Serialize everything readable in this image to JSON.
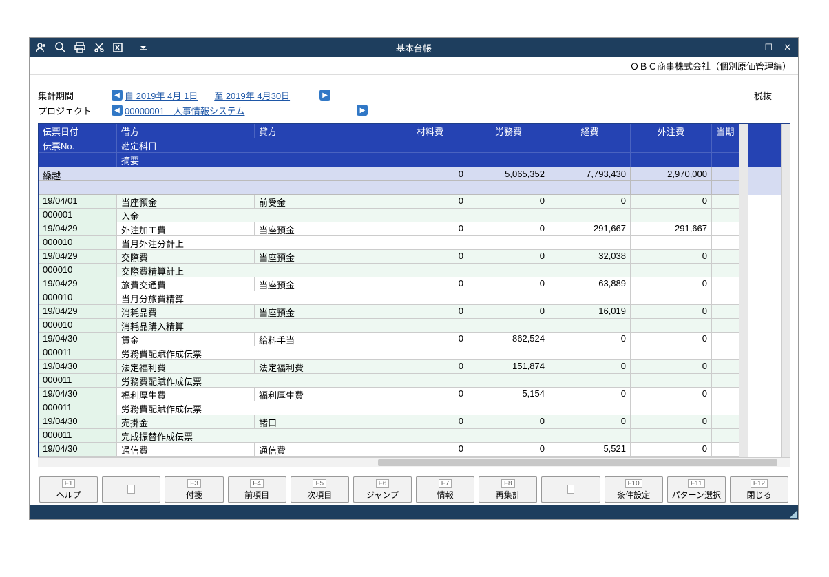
{
  "titlebar": {
    "title": "基本台帳"
  },
  "company": "ＯＢＣ商事株式会社（個別原価管理編）",
  "filters": {
    "period_label": "集計期間",
    "period_from": "自 2019年  4月 1日",
    "period_to": "至 2019年  4月30日",
    "project_label": "プロジェクト",
    "project_value": "00000001　人事情報システム"
  },
  "tax_label": "税抜",
  "headers": {
    "date": "伝票日付",
    "debit": "借方",
    "credit": "貸方",
    "material": "材料費",
    "labor": "労務費",
    "expense": "経費",
    "outsource": "外注費",
    "current": "当期",
    "slip_no": "伝票No.",
    "account": "勘定科目",
    "memo": "摘要"
  },
  "carryover": {
    "label": "繰越",
    "material": "0",
    "labor": "5,065,352",
    "expense": "7,793,430",
    "outsource": "2,970,000"
  },
  "rows": [
    {
      "date": "19/04/01",
      "no": "000001",
      "debit": "当座預金",
      "credit": "前受金",
      "memo": "入金",
      "material": "0",
      "labor": "0",
      "expense": "0",
      "outsource": "0",
      "alt": true
    },
    {
      "date": "19/04/29",
      "no": "000010",
      "debit": "外注加工費",
      "credit": "当座預金",
      "memo": "当月外注分計上",
      "material": "0",
      "labor": "0",
      "expense": "291,667",
      "outsource": "291,667",
      "alt": false
    },
    {
      "date": "19/04/29",
      "no": "000010",
      "debit": "交際費",
      "credit": "当座預金",
      "memo": "交際費精算計上",
      "material": "0",
      "labor": "0",
      "expense": "32,038",
      "outsource": "0",
      "alt": true
    },
    {
      "date": "19/04/29",
      "no": "000010",
      "debit": "旅費交通費",
      "credit": "当座預金",
      "memo": "当月分旅費精算",
      "material": "0",
      "labor": "0",
      "expense": "63,889",
      "outsource": "0",
      "alt": false
    },
    {
      "date": "19/04/29",
      "no": "000010",
      "debit": "消耗品費",
      "credit": "当座預金",
      "memo": "消耗品購入精算",
      "material": "0",
      "labor": "0",
      "expense": "16,019",
      "outsource": "0",
      "alt": true
    },
    {
      "date": "19/04/30",
      "no": "000011",
      "debit": "賃金",
      "credit": "給料手当",
      "memo": "労務費配賦作成伝票",
      "material": "0",
      "labor": "862,524",
      "expense": "0",
      "outsource": "0",
      "alt": false
    },
    {
      "date": "19/04/30",
      "no": "000011",
      "debit": "法定福利費",
      "credit": "法定福利費",
      "memo": "労務費配賦作成伝票",
      "material": "0",
      "labor": "151,874",
      "expense": "0",
      "outsource": "0",
      "alt": true
    },
    {
      "date": "19/04/30",
      "no": "000011",
      "debit": "福利厚生費",
      "credit": "福利厚生費",
      "memo": "労務費配賦作成伝票",
      "material": "0",
      "labor": "5,154",
      "expense": "0",
      "outsource": "0",
      "alt": false
    },
    {
      "date": "19/04/30",
      "no": "000011",
      "debit": "売掛金",
      "credit": "諸口",
      "memo": "完成振替作成伝票",
      "material": "0",
      "labor": "0",
      "expense": "0",
      "outsource": "0",
      "alt": true
    },
    {
      "date": "19/04/30",
      "no": "",
      "debit": "通信費",
      "credit": "通信費",
      "memo": "",
      "material": "0",
      "labor": "0",
      "expense": "5,521",
      "outsource": "0",
      "alt": false,
      "single": true
    }
  ],
  "fkeys": [
    {
      "k": "F1",
      "label": "ヘルプ"
    },
    {
      "k": "",
      "label": ""
    },
    {
      "k": "F3",
      "label": "付箋"
    },
    {
      "k": "F4",
      "label": "前項目"
    },
    {
      "k": "F5",
      "label": "次項目"
    },
    {
      "k": "F6",
      "label": "ジャンプ"
    },
    {
      "k": "F7",
      "label": "情報"
    },
    {
      "k": "F8",
      "label": "再集計"
    },
    {
      "k": "",
      "label": ""
    },
    {
      "k": "F10",
      "label": "条件設定"
    },
    {
      "k": "F11",
      "label": "パターン選択"
    },
    {
      "k": "F12",
      "label": "閉じる"
    }
  ]
}
